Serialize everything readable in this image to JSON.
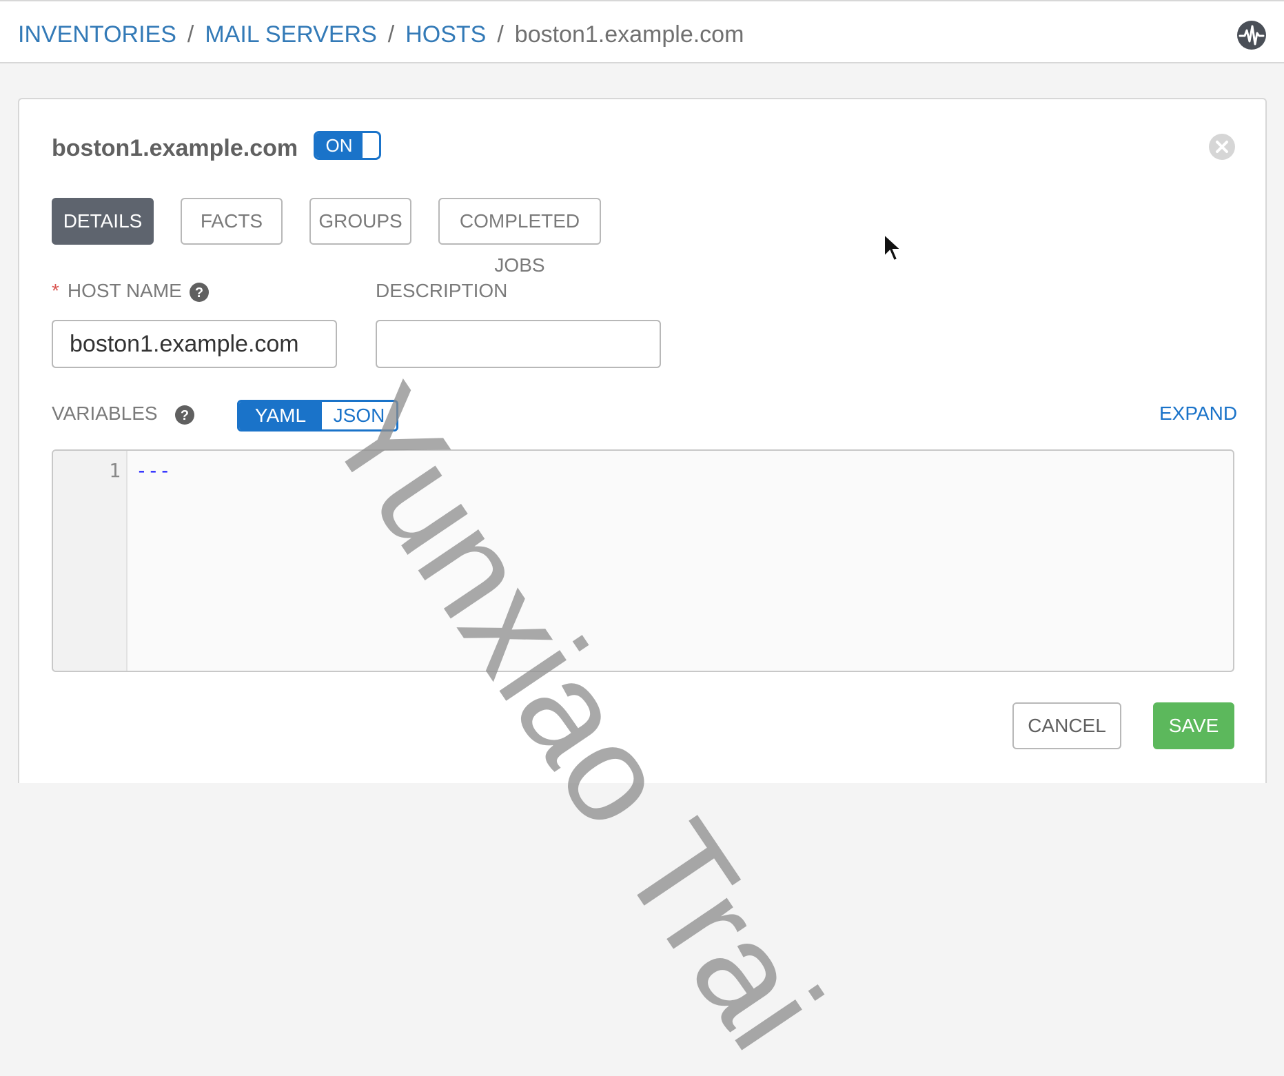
{
  "breadcrumb": {
    "items": [
      "INVENTORIES",
      "MAIL SERVERS",
      "HOSTS"
    ],
    "separator": "/",
    "current": "boston1.example.com"
  },
  "header": {
    "activity_icon": "activity-pulse-icon"
  },
  "panel": {
    "title": "boston1.example.com",
    "toggle_label": "ON",
    "close_icon": "close-circle-icon"
  },
  "tabs": [
    {
      "label": "DETAILS",
      "active": true
    },
    {
      "label": "FACTS",
      "active": false
    },
    {
      "label": "GROUPS",
      "active": false
    },
    {
      "label": "COMPLETED JOBS",
      "active": false
    }
  ],
  "form": {
    "host_name_label": "HOST NAME",
    "host_name_required_mark": "*",
    "host_name_value": "boston1.example.com",
    "description_label": "DESCRIPTION",
    "description_value": "",
    "variables_label": "VARIABLES",
    "format_options": [
      "YAML",
      "JSON"
    ],
    "format_selected": "YAML",
    "expand_label": "EXPAND",
    "editor": {
      "line_number": "1",
      "content": "---"
    }
  },
  "actions": {
    "cancel_label": "CANCEL",
    "save_label": "SAVE"
  },
  "watermark": "Yunxiao Trai",
  "colors": {
    "accent": "#1a73c9",
    "active_tab": "#5e646e",
    "save": "#5cb85c",
    "required": "#d9534f"
  }
}
